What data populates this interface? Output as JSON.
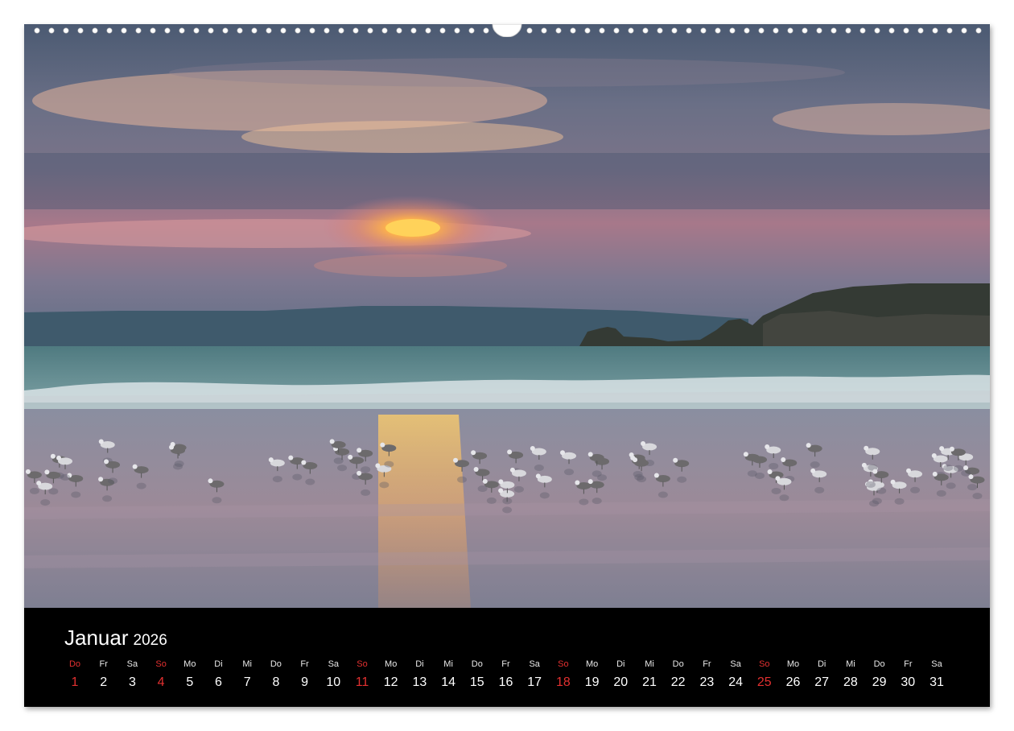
{
  "calendar": {
    "month": "Januar",
    "year": "2026",
    "weekday_labels": [
      "Do",
      "Fr",
      "Sa",
      "So",
      "Mo",
      "Di",
      "Mi",
      "Do",
      "Fr",
      "Sa",
      "So",
      "Mo",
      "Di",
      "Mi",
      "Do",
      "Fr",
      "Sa",
      "So",
      "Mo",
      "Di",
      "Mi",
      "Do",
      "Fr",
      "Sa",
      "So",
      "Mo",
      "Di",
      "Mi",
      "Do",
      "Fr",
      "Sa"
    ],
    "dates": [
      "1",
      "2",
      "3",
      "4",
      "5",
      "6",
      "7",
      "8",
      "9",
      "10",
      "11",
      "12",
      "13",
      "14",
      "15",
      "16",
      "17",
      "18",
      "19",
      "20",
      "21",
      "22",
      "23",
      "24",
      "25",
      "26",
      "27",
      "28",
      "29",
      "30",
      "31"
    ],
    "holiday_indices": [
      0,
      3,
      10,
      17,
      24
    ],
    "holiday_color": "#e23030"
  },
  "photo": {
    "subject": "seagulls-at-sunset-beach"
  }
}
